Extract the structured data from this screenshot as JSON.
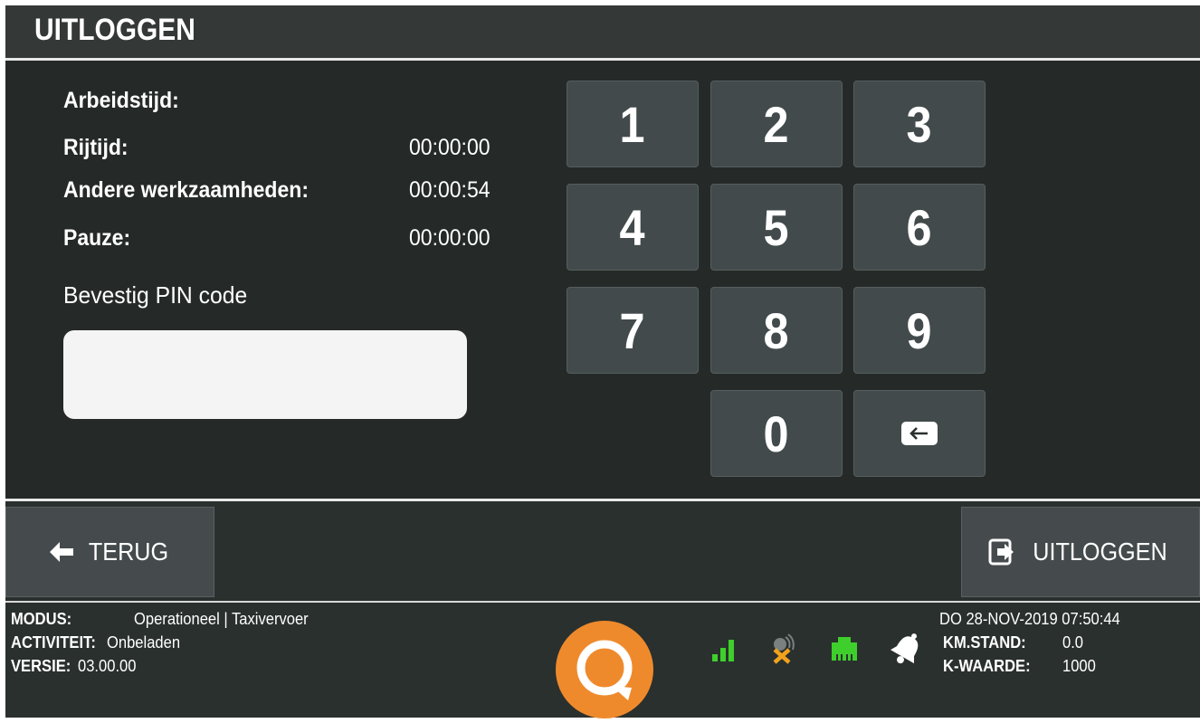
{
  "header": {
    "title": "UITLOGGEN"
  },
  "times": {
    "arbeidstijd_label": "Arbeidstijd:",
    "rijtijd_label": "Rijtijd:",
    "rijtijd_value": "00:00:00",
    "andere_label": "Andere werkzaamheden:",
    "andere_value": "00:00:54",
    "pauze_label": "Pauze:",
    "pauze_value": "00:00:00"
  },
  "pin": {
    "label": "Bevestig PIN code",
    "value": ""
  },
  "keypad": {
    "k1": "1",
    "k2": "2",
    "k3": "3",
    "k4": "4",
    "k5": "5",
    "k6": "6",
    "k7": "7",
    "k8": "8",
    "k9": "9",
    "k0": "0",
    "backspace_icon": "backspace-icon"
  },
  "actions": {
    "back_label": "TERUG",
    "logout_label": "UITLOGGEN",
    "back_icon": "arrow-left-icon",
    "logout_icon": "sign-out-icon"
  },
  "status": {
    "modus_label": "MODUS:",
    "modus_value": "Operationeel | Taxivervoer",
    "activiteit_label": "ACTIVITEIT:",
    "activiteit_value": "Onbeladen",
    "versie_label": "VERSIE:",
    "versie_value": "03.00.00",
    "datetime": "DO 28-NOV-2019 07:50:44",
    "kmstand_label": "KM.STAND:",
    "kmstand_value": "0.0",
    "kwaarde_label": "K-WAARDE:",
    "kwaarde_value": "1000",
    "icons": [
      "signal-icon",
      "gps-off-icon",
      "network-icon",
      "bell-icon",
      "brand-logo"
    ]
  },
  "colors": {
    "accent_green": "#3ecf2c",
    "accent_orange": "#ef8a2c",
    "background": "#2a302e"
  }
}
